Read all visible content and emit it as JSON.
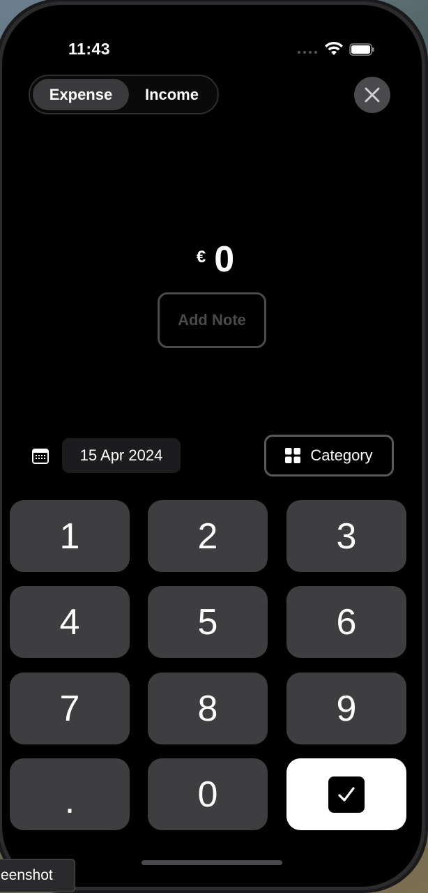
{
  "status_bar": {
    "time": "11:43"
  },
  "type_toggle": {
    "options": [
      "Expense",
      "Income"
    ],
    "selected": "Expense"
  },
  "amount": {
    "currency": "€",
    "value": "0"
  },
  "note": {
    "label": "Add Note"
  },
  "date": {
    "value": "15 Apr 2024"
  },
  "category": {
    "label": "Category"
  },
  "keypad": {
    "keys": [
      "1",
      "2",
      "3",
      "4",
      "5",
      "6",
      "7",
      "8",
      "9",
      ".",
      "0"
    ],
    "confirm_icon": "checkbox-check-icon"
  },
  "tooltip": {
    "text": "eenshot"
  },
  "colors": {
    "key_bg": "#3e3e40",
    "confirm_bg": "#ffffff",
    "background": "#000000"
  }
}
